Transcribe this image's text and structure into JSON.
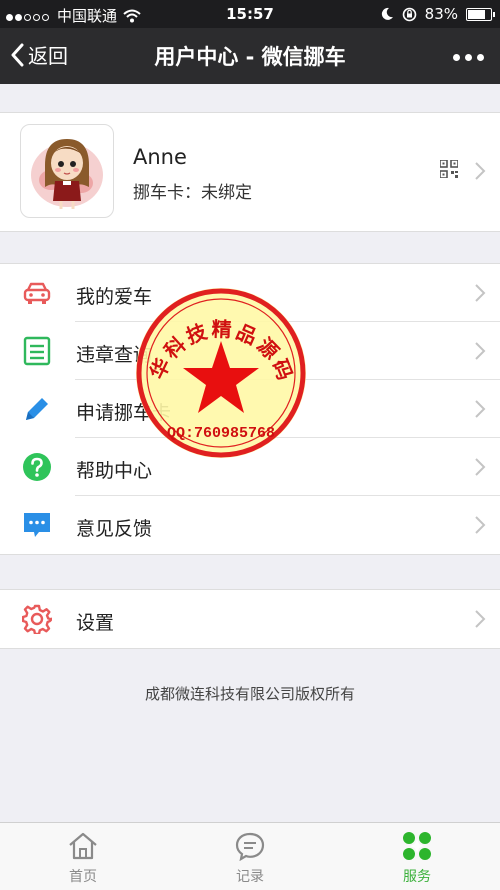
{
  "status_bar": {
    "carrier": "中国联通",
    "time": "15:57",
    "battery": "83%",
    "battery_level": 0.83
  },
  "navbar": {
    "back_label": "返回",
    "title": "用户中心 - 微信挪车"
  },
  "profile": {
    "name": "Anne",
    "card_label": "挪车卡：未绑定"
  },
  "menu": [
    {
      "label": "我的爱车",
      "icon": "car-icon",
      "color": "#e85a5a"
    },
    {
      "label": "违章查询",
      "icon": "document-list-icon",
      "color": "#2fb85c"
    },
    {
      "label": "申请挪车卡",
      "icon": "pencil-icon",
      "color": "#2a8fe6"
    },
    {
      "label": "帮助中心",
      "icon": "question-icon",
      "color": "#2fc45a"
    },
    {
      "label": "意见反馈",
      "icon": "chat-icon",
      "color": "#2a8fe6"
    }
  ],
  "settings": {
    "label": "设置",
    "icon": "gear-icon",
    "color": "#e85a5a"
  },
  "copyright": "成都微连科技有限公司版权所有",
  "watermark": {
    "top_text": "华科技精品源码",
    "bottom_text": "QQ:760985768"
  },
  "tabbar": [
    {
      "label": "首页",
      "icon": "home-icon",
      "active": false
    },
    {
      "label": "记录",
      "icon": "chat-bubble-icon",
      "active": false
    },
    {
      "label": "服务",
      "icon": "services-icon",
      "active": true
    }
  ],
  "colors": {
    "accent": "#3cb13c",
    "navbar": "#2c2c2e"
  }
}
